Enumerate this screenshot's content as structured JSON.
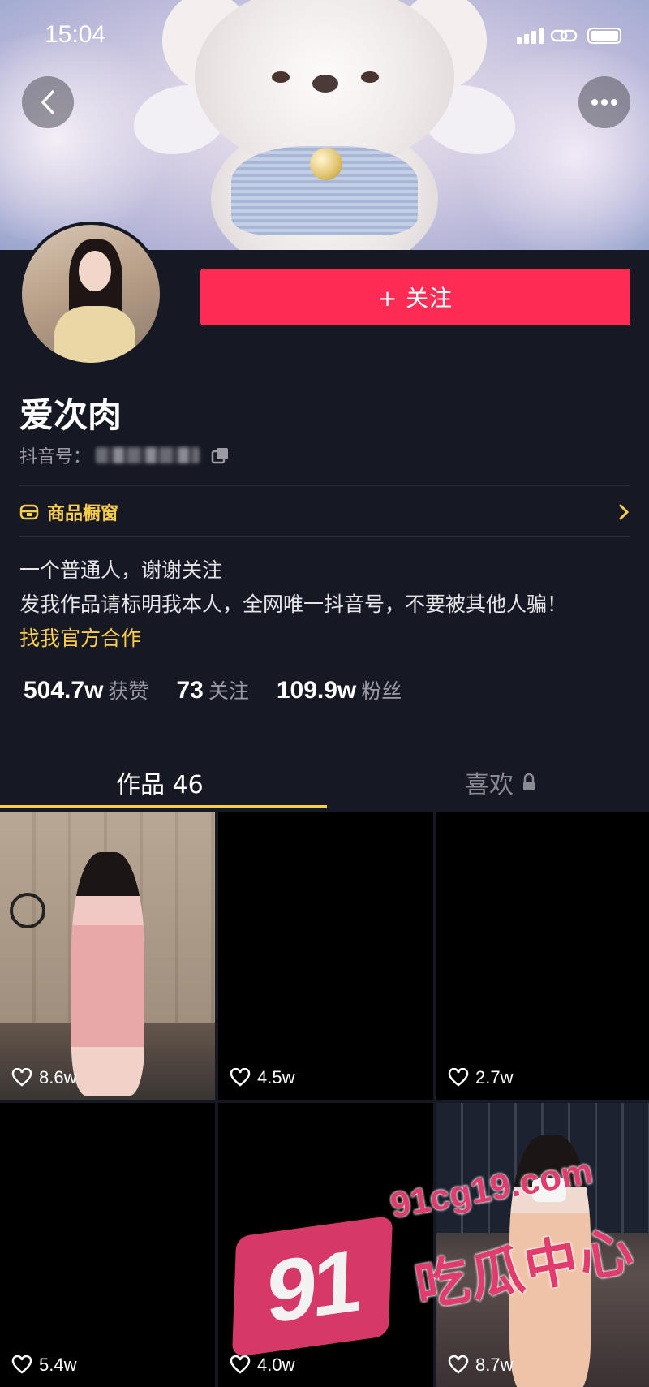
{
  "status_bar": {
    "time": "15:04"
  },
  "profile": {
    "follow_label": "+ 关注",
    "name": "爱次肉",
    "id_label": "抖音号：",
    "shop_label": "商品橱窗",
    "bio_lines": [
      "一个普通人，谢谢关注",
      "发我作品请标明我本人，全网唯一抖音号，不要被其他人骗！"
    ],
    "bio_link": "找我官方合作"
  },
  "stats": [
    {
      "value": "504.7w",
      "label": "获赞"
    },
    {
      "value": "73",
      "label": "关注"
    },
    {
      "value": "109.9w",
      "label": "粉丝"
    }
  ],
  "tabs": {
    "works": "作品 46",
    "likes": "喜欢"
  },
  "videos": [
    {
      "likes": "8.6w"
    },
    {
      "likes": "4.5w"
    },
    {
      "likes": "2.7w"
    },
    {
      "likes": "5.4w"
    },
    {
      "likes": "4.0w"
    },
    {
      "likes": "8.7w"
    }
  ],
  "watermark": {
    "badge": "91",
    "url": "91cg19.com",
    "text": "吃瓜中心"
  },
  "colors": {
    "accent": "#fe2c55",
    "gold": "#facd4a",
    "background": "#161823"
  }
}
